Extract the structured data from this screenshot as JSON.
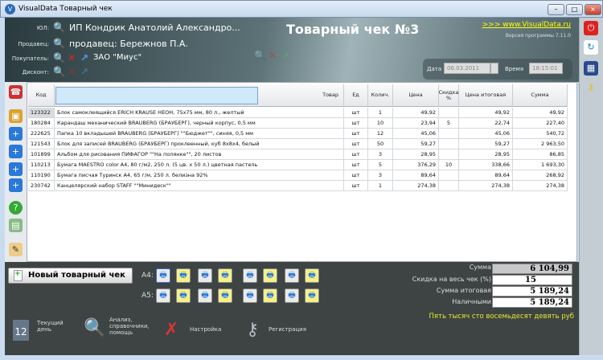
{
  "window": {
    "title": "VisualData Товарный чек",
    "min": "–",
    "max": "□",
    "close": "×"
  },
  "header": {
    "title": "Товарный чек №3",
    "link": ">>> www.VisualData.ru",
    "version": "Версия программы 7.11.0",
    "org_label": "ЮЛ:",
    "org": "ИП Кондрик Анатолий Александро...",
    "seller_label": "Продавец:",
    "seller": "продавец: Бережнов П.А.",
    "buyer_label": "Покупатель:",
    "buyer": "ЗАО \"Миус\"",
    "discount_label": "Дисконт:",
    "date_label": "Дата",
    "date": "06.03.2011",
    "time_label": "Время",
    "time": "18:15:01"
  },
  "table": {
    "headers": [
      "Код",
      "Товар",
      "Ед",
      "Колич.",
      "Цена",
      "Скидка %",
      "Цена итоговая",
      "Сумма"
    ],
    "search_value": "",
    "rows": [
      [
        "123322",
        "Блок самоклеящийся ERICH KRAUSE НЕОН, 75х75 мм, 80 л., желтый",
        "шт",
        "1",
        "49,92",
        "",
        "49,92",
        "49,92"
      ],
      [
        "180284",
        "Карандаш механический BRAUBERG (БРАУБЕРГ), черный корпус, 0,5 мм",
        "шт",
        "10",
        "23,94",
        "5",
        "22,74",
        "227,40"
      ],
      [
        "222625",
        "Папка 10 вкладышей BRAUBERG (БРАУБЕРГ) \"\"Бюджет\"\", синяя, 0,5 мм",
        "шт",
        "12",
        "45,06",
        "",
        "45,06",
        "540,72"
      ],
      [
        "121543",
        "Блок для записей BRAUBERG (БРАУБЕРГ) проклеенный, куб 8х8х4, белый",
        "шт",
        "50",
        "59,27",
        "",
        "59,27",
        "2 963,50"
      ],
      [
        "101899",
        "Альбом для рисования ПИФАГОР \"\"На полянке\"\", 20 листов",
        "шт",
        "3",
        "28,95",
        "",
        "28,95",
        "86,85"
      ],
      [
        "110213",
        "Бумага MAESTRO color А4, 80 г/м2, 250 л. (5 цв. х 50 л.) цветная пастель",
        "шт",
        "5",
        "376,29",
        "10",
        "338,66",
        "1 693,30"
      ],
      [
        "110190",
        "Бумага писчая Туринск А4, 65 г/м, 250 л. белизна 92%",
        "шт",
        "3",
        "89,64",
        "",
        "89,64",
        "268,92"
      ],
      [
        "230742",
        "Канцелярский набор STAFF \"\"Минидеск\"\"",
        "шт",
        "1",
        "274,38",
        "",
        "274,38",
        "274,38"
      ]
    ]
  },
  "bottom": {
    "new_receipt": "Новый товарный чек",
    "a4": "А4:",
    "a5": "А5:",
    "sum_label": "Сумма",
    "sum": "6 104,99",
    "discount_label": "Скидка на весь чек (%)",
    "discount": "15",
    "total_label": "Сумма итоговая",
    "total": "5 189,24",
    "cash_label": "Наличными",
    "cash": "5 189,24",
    "words": "Пять тысяч сто восемьдесят девять руб",
    "tools": [
      "Текущий день",
      "Анализ, справочники, помощь",
      "Настройка",
      "Регистрация"
    ],
    "calendar_day": "12"
  }
}
